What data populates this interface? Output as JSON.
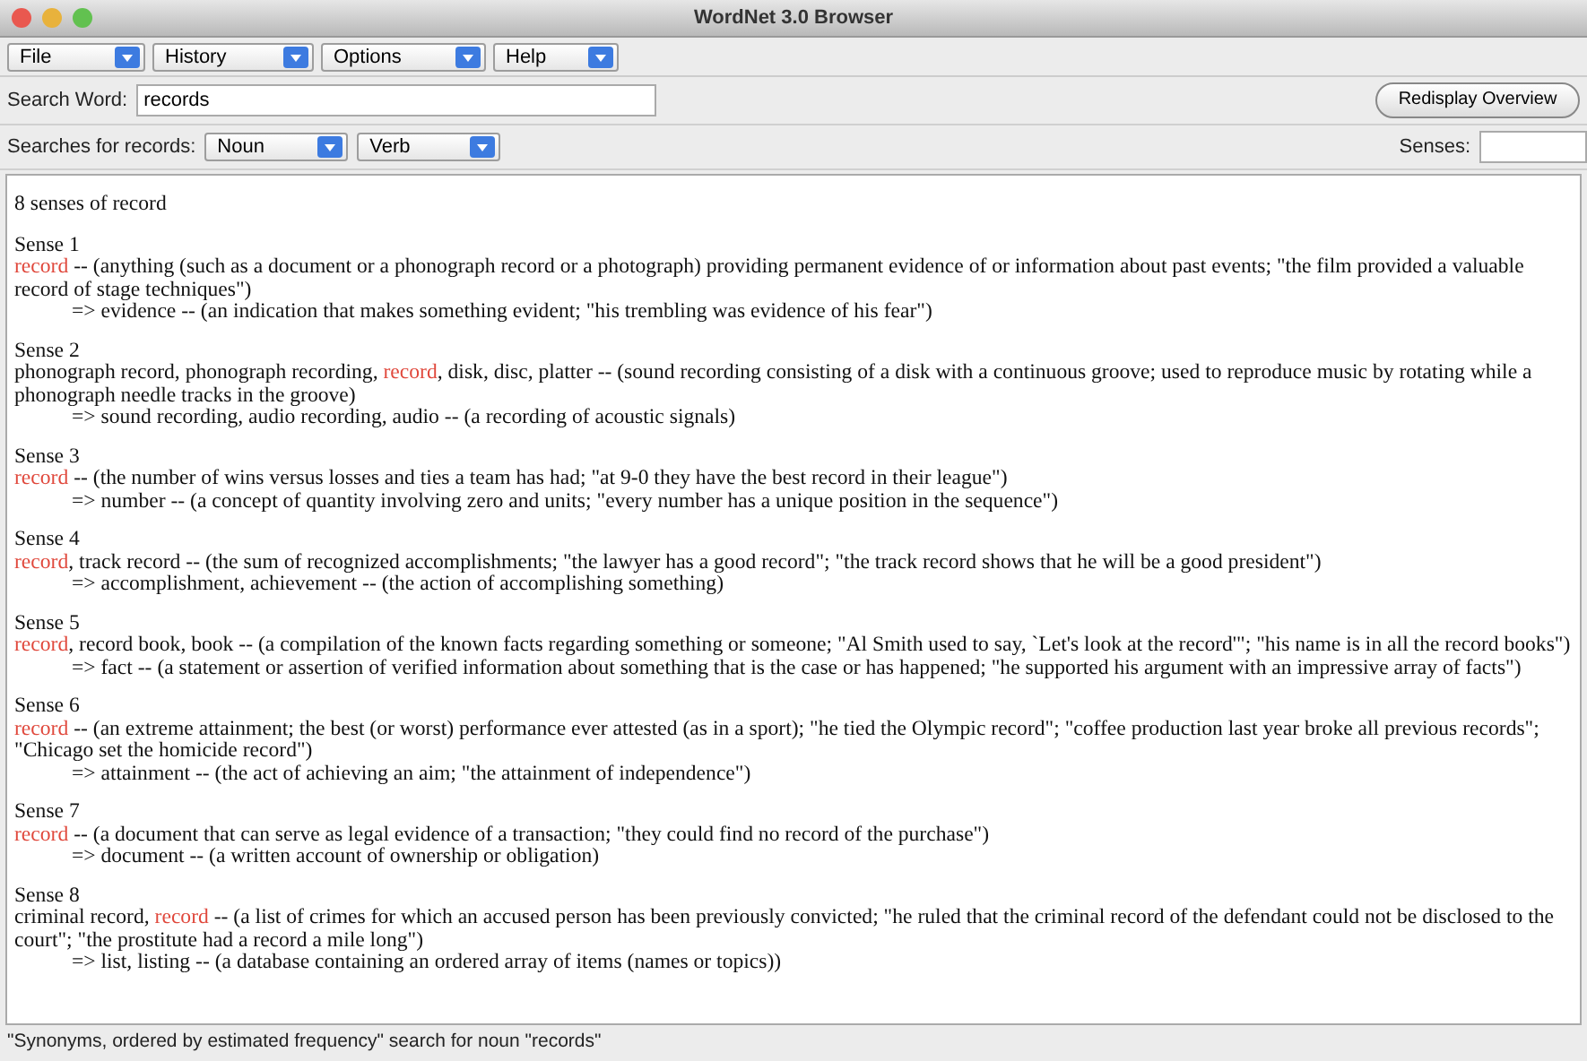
{
  "window": {
    "title": "WordNet 3.0 Browser"
  },
  "menus": [
    "File",
    "History",
    "Options",
    "Help"
  ],
  "search": {
    "label": "Search Word:",
    "value": "records",
    "button": "Redisplay Overview"
  },
  "searches": {
    "label": "Searches for records:",
    "pos": [
      "Noun",
      "Verb"
    ],
    "senses_label": "Senses:"
  },
  "results": {
    "summary": "8 senses of record",
    "senses": [
      {
        "heading": "Sense 1",
        "synset": [
          {
            "text": "record",
            "hit": true
          },
          {
            "text": " -- (anything (such as a document or a phonograph record or a photograph) providing permanent evidence of or information about past events; \"the film provided a valuable record of stage techniques\")",
            "hit": false
          }
        ],
        "hypernym": "=> evidence -- (an indication that makes something evident; \"his trembling was evidence of his fear\")"
      },
      {
        "heading": "Sense 2",
        "synset": [
          {
            "text": "phonograph record, phonograph recording, ",
            "hit": false
          },
          {
            "text": "record",
            "hit": true
          },
          {
            "text": ", disk, disc, platter -- (sound recording consisting of a disk with a continuous groove; used to reproduce music by rotating while a phonograph needle tracks in the groove)",
            "hit": false
          }
        ],
        "hypernym": "=> sound recording, audio recording, audio -- (a recording of acoustic signals)"
      },
      {
        "heading": "Sense 3",
        "synset": [
          {
            "text": "record",
            "hit": true
          },
          {
            "text": " -- (the number of wins versus losses and ties a team has had; \"at 9-0 they have the best record in their league\")",
            "hit": false
          }
        ],
        "hypernym": "=> number -- (a concept of quantity involving zero and units; \"every number has a unique position in the sequence\")"
      },
      {
        "heading": "Sense 4",
        "synset": [
          {
            "text": "record",
            "hit": true
          },
          {
            "text": ", track record -- (the sum of recognized accomplishments; \"the lawyer has a good record\"; \"the track record shows that he will be a good president\")",
            "hit": false
          }
        ],
        "hypernym": "=> accomplishment, achievement -- (the action of accomplishing something)"
      },
      {
        "heading": "Sense 5",
        "synset": [
          {
            "text": "record",
            "hit": true
          },
          {
            "text": ", record book, book -- (a compilation of the known facts regarding something or someone; \"Al Smith used to say, `Let's look at the record'\"; \"his name is in all the record books\")",
            "hit": false
          }
        ],
        "hypernym": "=> fact -- (a statement or assertion of verified information about something that is the case or has happened; \"he supported his argument with an impressive array of facts\")"
      },
      {
        "heading": "Sense 6",
        "synset": [
          {
            "text": "record",
            "hit": true
          },
          {
            "text": " -- (an extreme attainment; the best (or worst) performance ever attested (as in a sport); \"he tied the Olympic record\"; \"coffee production last year broke all previous records\"; \"Chicago set the homicide record\")",
            "hit": false
          }
        ],
        "hypernym": "=> attainment -- (the act of achieving an aim; \"the attainment of independence\")"
      },
      {
        "heading": "Sense 7",
        "synset": [
          {
            "text": "record",
            "hit": true
          },
          {
            "text": " -- (a document that can serve as legal evidence of a transaction; \"they could find no record of the purchase\")",
            "hit": false
          }
        ],
        "hypernym": "=> document -- (a written account of ownership or obligation)"
      },
      {
        "heading": "Sense 8",
        "synset": [
          {
            "text": "criminal record, ",
            "hit": false
          },
          {
            "text": "record",
            "hit": true
          },
          {
            "text": " -- (a list of crimes for which an accused person has been previously convicted; \"he ruled that the criminal record of the defendant could not be disclosed to the court\"; \"the prostitute had a record a mile long\")",
            "hit": false
          }
        ],
        "hypernym": "=> list, listing -- (a database containing an ordered array of items (names or topics))"
      }
    ]
  },
  "status_bar": "\"Synonyms, ordered by estimated frequency\" search for noun \"records\""
}
